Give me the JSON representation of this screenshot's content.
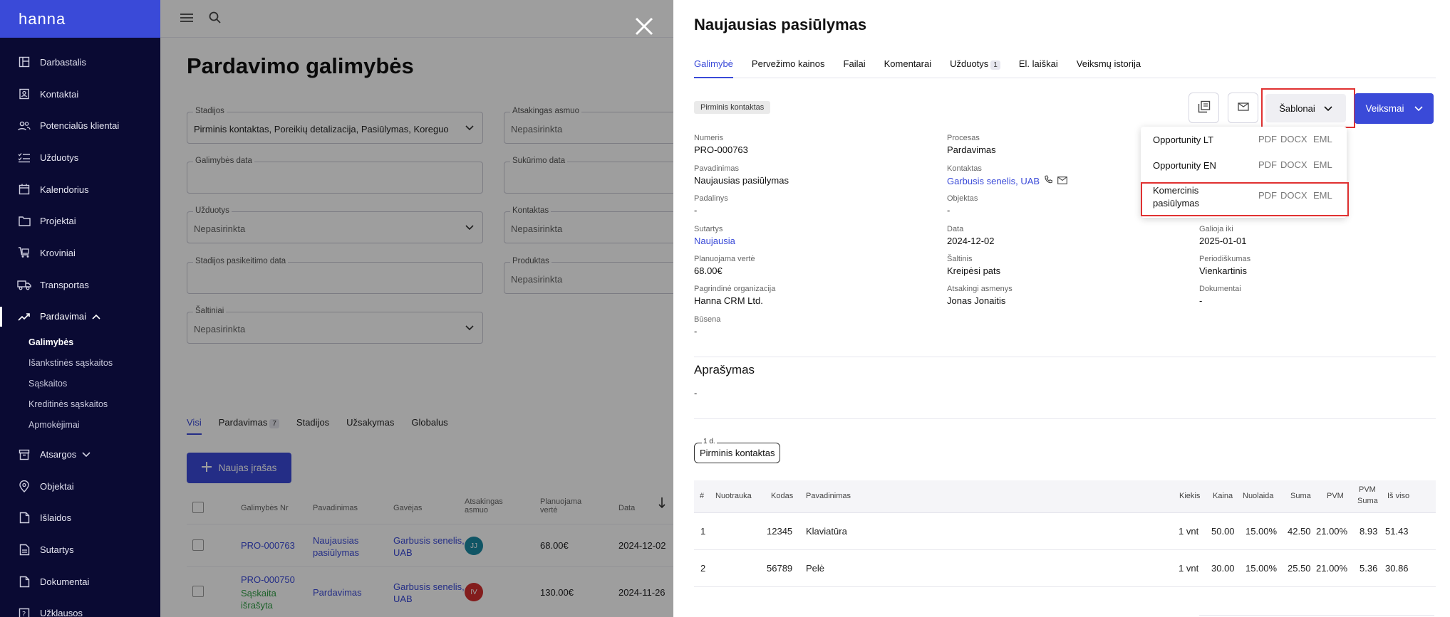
{
  "app": {
    "logo": "hanna"
  },
  "sidebar": {
    "items": [
      {
        "label": "Darbastalis",
        "icon": "dashboard-icon"
      },
      {
        "label": "Kontaktai",
        "icon": "contacts-icon"
      },
      {
        "label": "Potencialūs klientai",
        "icon": "leads-icon"
      },
      {
        "label": "Užduotys",
        "icon": "tasks-icon"
      },
      {
        "label": "Kalendorius",
        "icon": "calendar-icon"
      },
      {
        "label": "Projektai",
        "icon": "folder-icon"
      },
      {
        "label": "Kroviniai",
        "icon": "cargo-icon"
      },
      {
        "label": "Transportas",
        "icon": "truck-icon"
      },
      {
        "label": "Pardavimai",
        "icon": "trend-icon"
      },
      {
        "label": "Atsargos",
        "icon": "archive-icon"
      },
      {
        "label": "Objektai",
        "icon": "pin-icon"
      },
      {
        "label": "Išlaidos",
        "icon": "expense-icon"
      },
      {
        "label": "Sutartys",
        "icon": "contract-icon"
      },
      {
        "label": "Dokumentai",
        "icon": "document-icon"
      },
      {
        "label": "Užklausos",
        "icon": "inquiry-icon"
      }
    ],
    "sub": [
      "Galimybės",
      "Išankstinės sąskaitos",
      "Sąskaitos",
      "Kreditinės sąskaitos",
      "Apmokėjimai"
    ]
  },
  "main": {
    "title": "Pardavimo galimybės",
    "filters": {
      "stadijos_label": "Stadijos",
      "stadijos_value": "Pirminis kontaktas, Poreikių detalizacija, Pasiūlymas, Koreguo",
      "atsakingas_label": "Atsakingas asmuo",
      "atsakingas_value": "Nepasirinkta",
      "galimybes_data_label": "Galimybės data",
      "sukurimo_label": "Sukūrimo data",
      "uzduotys_label": "Užduotys",
      "uzduotys_value": "Nepasirinkta",
      "kontaktas_label": "Kontaktas",
      "kontaktas_value": "Nepasirinkta",
      "stadijos_data_label": "Stadijos pasikeitimo data",
      "produktas_label": "Produktas",
      "produktas_value": "Nepasirinkta",
      "saltiniai_label": "Šaltiniai",
      "saltiniai_value": "Nepasirinkta"
    },
    "tabs": {
      "visi": "Visi",
      "pardavimas": "Pardavimas",
      "pardavimas_count": "7",
      "stadijos": "Stadijos",
      "uzsakymas": "Užsakymas",
      "globalus": "Globalus"
    },
    "new_button": "Naujas įrašas",
    "columns": {
      "nr": "Galimybės Nr",
      "pav": "Pavadinimas",
      "gavejas": "Gavėjas",
      "atsakingas": "Atsakingas asmuo",
      "verte": "Planuojama vertė",
      "data": "Data"
    },
    "rows": [
      {
        "nr": "PRO-000763",
        "pav": "Naujausias pasiūlymas",
        "gavejas": "Garbusis senelis, UAB",
        "avatar": "JJ",
        "verte": "68.00€",
        "data": "2024-12-02"
      },
      {
        "nr": "PRO-000750",
        "status": "Sąskaita išrašyta",
        "pav": "Pardavimas",
        "gavejas": "Garbusis senelis, UAB",
        "avatar": "IV",
        "verte": "130.00€",
        "data": "2024-11-26"
      }
    ]
  },
  "drawer": {
    "title": "Naujausias pasiūlymas",
    "tabs": [
      "Galimybė",
      "Pervežimo kainos",
      "Failai",
      "Komentarai",
      "Užduotys",
      "El. laiškai",
      "Veiksmų istorija"
    ],
    "tasks_count": "1",
    "stage_badge": "Pirminis kontaktas",
    "sablonai": "Šablonai",
    "veiksmai": "Veiksmai",
    "templates": [
      {
        "name": "Opportunity LT",
        "formats": [
          "PDF",
          "DOCX",
          "EML"
        ]
      },
      {
        "name": "Opportunity EN",
        "formats": [
          "PDF",
          "DOCX",
          "EML"
        ]
      },
      {
        "name": "Komercinis pasiūlymas",
        "formats": [
          "PDF",
          "DOCX",
          "EML"
        ]
      }
    ],
    "info": {
      "numeris_k": "Numeris",
      "numeris_v": "PRO-000763",
      "procesas_k": "Procesas",
      "procesas_v": "Pardavimas",
      "pavadinimas_k": "Pavadinimas",
      "pavadinimas_v": "Naujausias pasiūlymas",
      "kontaktas_k": "Kontaktas",
      "kontaktas_v": "Garbusis senelis, UAB",
      "padalinys_k": "Padalinys",
      "padalinys_v": "-",
      "objektas_k": "Objektas",
      "objektas_v": "-",
      "sutartys_k": "Sutartys",
      "sutartys_v": "Naujausia",
      "data_k": "Data",
      "data_v": "2024-12-02",
      "galioja_k": "Galioja iki",
      "galioja_v": "2025-01-01",
      "verte_k": "Planuojama vertė",
      "verte_v": "68.00€",
      "saltinis_k": "Šaltinis",
      "saltinis_v": "Kreipėsi pats",
      "period_k": "Periodiškumas",
      "period_v": "Vienkartinis",
      "org_k": "Pagrindinė organizacija",
      "org_v": "Hanna CRM Ltd.",
      "atsak_k": "Atsakingi asmenys",
      "atsak_v": "Jonas Jonaitis",
      "dok_k": "Dokumentai",
      "dok_v": "-",
      "busena_k": "Būsena",
      "busena_v": "-"
    },
    "aprasymas": "Aprašymas",
    "aprasymas_v": "-",
    "stage_days": "1 d.",
    "stage_name": "Pirminis kontaktas",
    "products": {
      "cols": {
        "hash": "#",
        "nuotrauka": "Nuotrauka",
        "kodas": "Kodas",
        "pav": "Pavadinimas",
        "kiekis": "Kiekis",
        "kaina": "Kaina",
        "nuolaida": "Nuolaida",
        "suma": "Suma",
        "pvm": "PVM",
        "pvm_suma_1": "PVM",
        "pvm_suma_2": "Suma",
        "is_viso": "Iš viso"
      },
      "rows": [
        {
          "n": "1",
          "kodas": "12345",
          "pav": "Klaviatūra",
          "kiekis": "1 vnt",
          "kaina": "50.00",
          "nuolaida": "15.00%",
          "suma": "42.50",
          "pvm": "21.00%",
          "pvm_suma": "8.93",
          "is_viso": "51.43"
        },
        {
          "n": "2",
          "kodas": "56789",
          "pav": "Pelė",
          "kiekis": "1 vnt",
          "kaina": "30.00",
          "nuolaida": "15.00%",
          "suma": "25.50",
          "pvm": "21.00%",
          "pvm_suma": "5.36",
          "is_viso": "30.86"
        }
      ]
    }
  }
}
